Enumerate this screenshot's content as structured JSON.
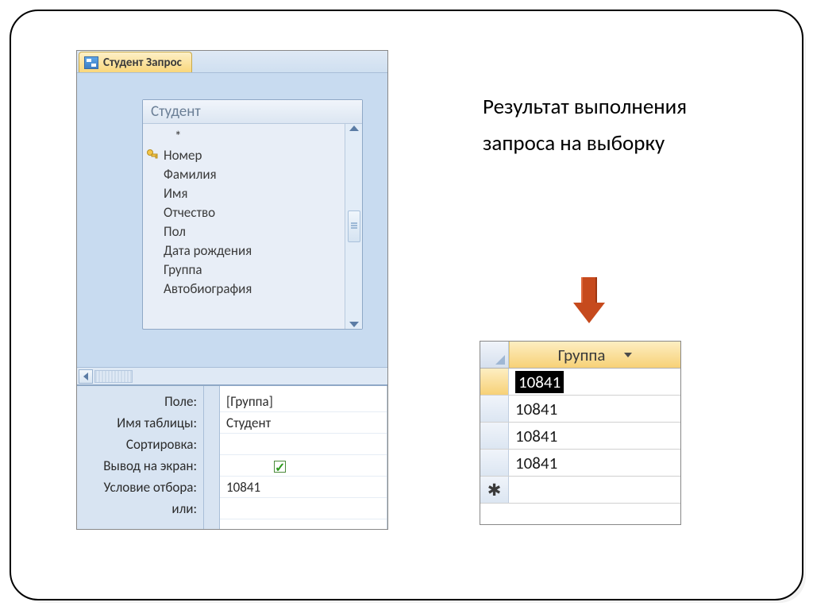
{
  "tab": {
    "title": "Студент Запрос"
  },
  "table": {
    "title": "Студент",
    "star": "*",
    "fields": [
      "Номер",
      "Фамилия",
      "Имя",
      "Отчество",
      "Пол",
      "Дата рождения",
      "Группа",
      "Автобиография"
    ]
  },
  "qbe": {
    "labels": {
      "field": "Поле:",
      "table": "Имя таблицы:",
      "sort": "Сортировка:",
      "show": "Вывод на экран:",
      "criteria": "Условие отбора:",
      "or": "или:"
    },
    "col1": {
      "field": "[Группа]",
      "table": "Студент",
      "sort": "",
      "criteria": "10841"
    }
  },
  "caption": "Результат выполнения запроса на выборку",
  "result": {
    "column": "Группа",
    "rows": [
      "10841",
      "10841",
      "10841",
      "10841"
    ],
    "new_row_glyph": "✱"
  }
}
